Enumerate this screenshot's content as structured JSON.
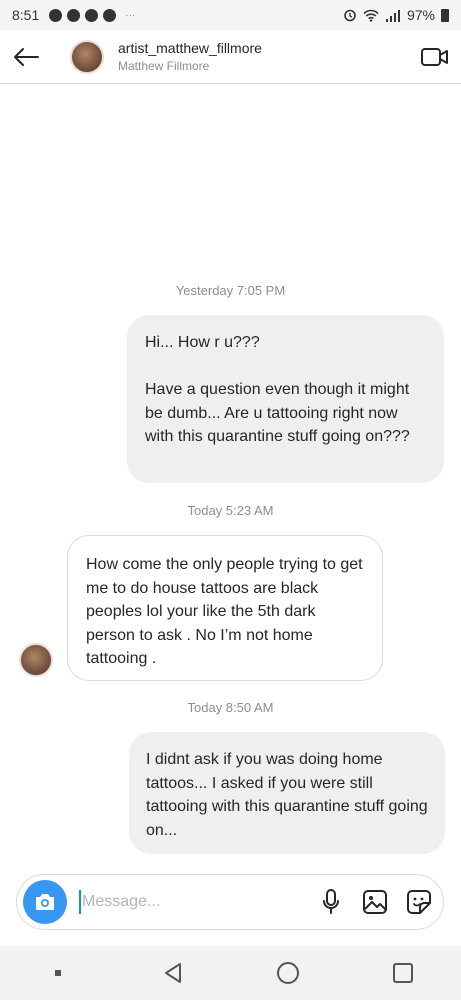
{
  "status_bar": {
    "time": "8:51",
    "overflow": "···",
    "battery": "97%",
    "icons": [
      "pinterest-icon",
      "snapchat-icon",
      "facebook-icon",
      "app-icon",
      "alarm-icon",
      "wifi-icon",
      "signal-icon",
      "battery-icon"
    ]
  },
  "header": {
    "username": "artist_matthew_fillmore",
    "full_name": "Matthew Fillmore"
  },
  "thread": {
    "timestamps": [
      "Yesterday 7:05 PM",
      "Today 5:23 AM",
      "Today 8:50 AM"
    ],
    "messages": [
      {
        "sender": "me",
        "text": "Hi... How r u???\n\nHave a question even though it might be dumb... Are u tattooing right now with this quarantine stuff going on???"
      },
      {
        "sender": "them",
        "text": "How come the only people trying to get me to do house tattoos are black peoples lol your like the 5th dark person to ask . No I’m not home tattooing ."
      },
      {
        "sender": "me",
        "text": "I didnt ask if you was doing home tattoos... I asked if you were still tattooing with this quarantine stuff going on..."
      }
    ]
  },
  "composer": {
    "placeholder": "Message..."
  },
  "colors": {
    "accent": "#3897f0",
    "sent_bubble": "#efefef",
    "received_border": "#dbdbdb",
    "muted_text": "#8e8e8e"
  }
}
